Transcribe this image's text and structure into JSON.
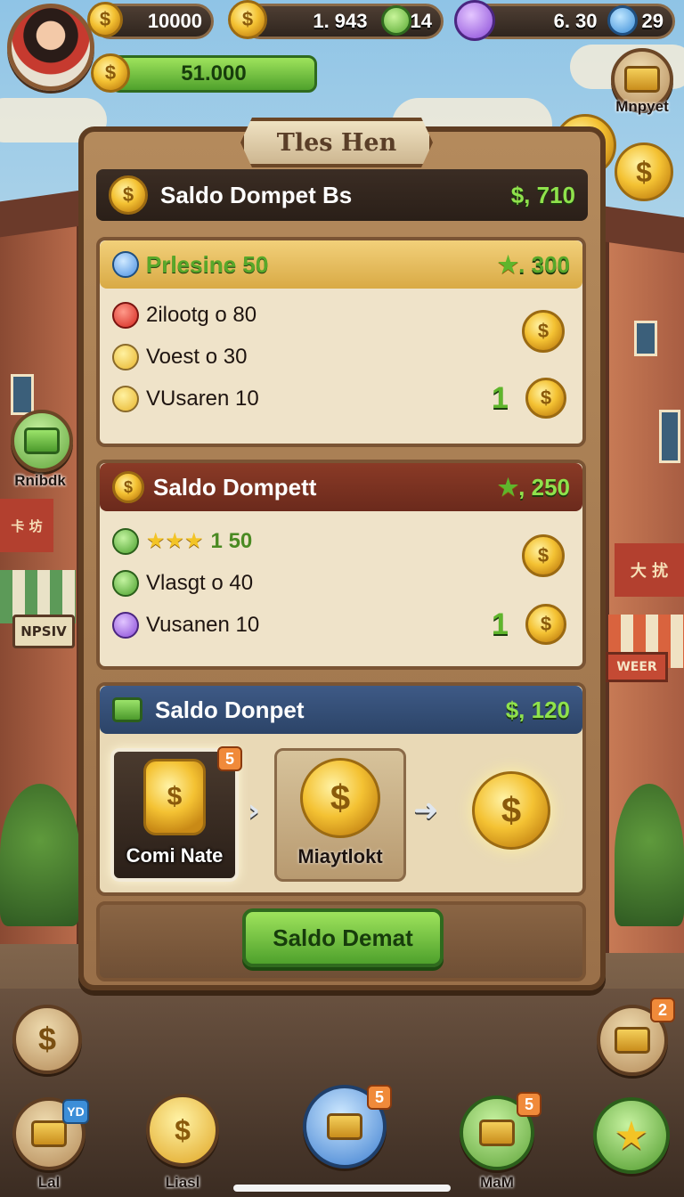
{
  "hud": {
    "coins": "10000",
    "coins_icon": "$",
    "energy": "1. 943",
    "energy_count": "14",
    "gems": "6. 30",
    "gems_count": "29",
    "wallet_bar": "51.000"
  },
  "top_right": {
    "button_label": "Mnpyet"
  },
  "left_side": {
    "button_label": "Rnibdk"
  },
  "panel": {
    "banner": "Tles Hen",
    "main_header": {
      "title": "Saldo Dompet  Bs",
      "amount": "$, 710"
    },
    "section1": {
      "header": {
        "title": "Prlesine  50",
        "amount": ". 300"
      },
      "rows": [
        {
          "label": "2ilootg  o  80",
          "icon": "heart-icon"
        },
        {
          "label": "Voest  o  30",
          "icon": "coin-icon"
        },
        {
          "label": "VUsaren  10",
          "icon": "coin-icon"
        }
      ],
      "side_number": "1"
    },
    "section2": {
      "header": {
        "title": "Saldo Dompett",
        "amount": ", 250"
      },
      "rows": [
        {
          "label": "1  50",
          "stars": "★★★",
          "icon": "green-coin-icon"
        },
        {
          "label": "Vlasgt  o  40",
          "icon": "green-coin-icon"
        },
        {
          "label": "Vusanen  10",
          "icon": "purple-coin-icon"
        }
      ],
      "side_number": "1"
    },
    "section3": {
      "header": {
        "title": "Saldo Donpet",
        "amount": "$, 120"
      },
      "cards": [
        {
          "label": "Comi Nate",
          "badge": "5"
        },
        {
          "label": "Miaytlokt"
        }
      ]
    },
    "cta": "Saldo Demat"
  },
  "bottom_nav": {
    "items": [
      {
        "label": "Lal",
        "badge": "YD"
      },
      {
        "label": "Liasl"
      },
      {
        "label": "",
        "badge": "5"
      },
      {
        "label": "MaM",
        "badge": "5"
      }
    ],
    "right_badge": "2"
  },
  "colors": {
    "accent_green": "#5fb52c",
    "panel_wood": "#9a7049",
    "gold": "#f4c233"
  }
}
